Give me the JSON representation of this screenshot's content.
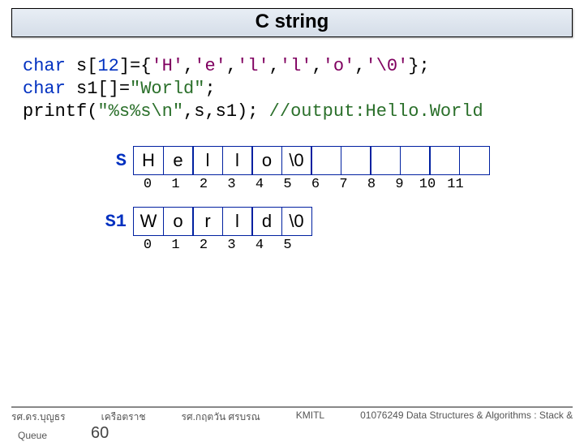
{
  "title": "C string",
  "code": {
    "l1a": "char",
    "l1b": " s[",
    "l1c": "12",
    "l1d": "]={",
    "l1e": "'H'",
    "l1f": ",",
    "l1g": "'e'",
    "l1h": ",",
    "l1i": "'l'",
    "l1j": ",",
    "l1k": "'l'",
    "l1l": ",",
    "l1m": "'o'",
    "l1n": ",",
    "l1o": "'\\0'",
    "l1p": "};",
    "l2a": "char",
    "l2b": " s1[]=",
    "l2c": "\"World\"",
    "l2d": ";",
    "l3a": "printf(",
    "l3b": "\"%s%s\\n\"",
    "l3c": ",s,s1); ",
    "l3d": "//output:Hello.World"
  },
  "arrays": {
    "s": {
      "label": "S",
      "cells": [
        "H",
        "e",
        "l",
        "l",
        "o",
        "\\0",
        "",
        "",
        "",
        "",
        "",
        ""
      ],
      "idx": [
        "0",
        "1",
        "2",
        "3",
        "4",
        "5",
        "6",
        "7",
        "8",
        "9",
        "10",
        "11"
      ]
    },
    "s1": {
      "label": "S1",
      "cells": [
        "W",
        "o",
        "r",
        "l",
        "d",
        "\\0"
      ],
      "idx": [
        "0",
        "1",
        "2",
        "3",
        "4",
        "5"
      ]
    }
  },
  "footer": {
    "author": "รศ.ดร.บุญธร",
    "a2": "เครือตราช",
    "a3": "รศ.กฤตวัน   ศรบรณ",
    "org": "KMITL",
    "course": "01076249 Data Structures & Algorithms : Stack &",
    "queue": "Queue",
    "page": "60"
  }
}
